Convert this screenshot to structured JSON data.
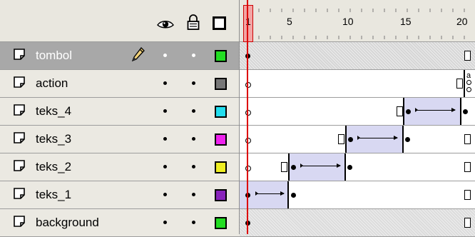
{
  "header": {
    "icons": {
      "visibility": "eye-icon",
      "lock": "padlock-icon",
      "outline": "outline-square-icon"
    },
    "frame_numbers": [
      "5",
      "10",
      "15",
      "20"
    ],
    "playhead_frame": "1"
  },
  "layers": [
    {
      "name": "tombol",
      "selected": true,
      "color": "#22dd22"
    },
    {
      "name": "action",
      "selected": false,
      "color": "#777777"
    },
    {
      "name": "teks_4",
      "selected": false,
      "color": "#22ddee"
    },
    {
      "name": "teks_3",
      "selected": false,
      "color": "#ee22ee"
    },
    {
      "name": "teks_2",
      "selected": false,
      "color": "#eeee22"
    },
    {
      "name": "teks_1",
      "selected": false,
      "color": "#8822bb"
    },
    {
      "name": "background",
      "selected": false,
      "color": "#22dd22"
    }
  ],
  "frames": {
    "action_label": "a"
  }
}
